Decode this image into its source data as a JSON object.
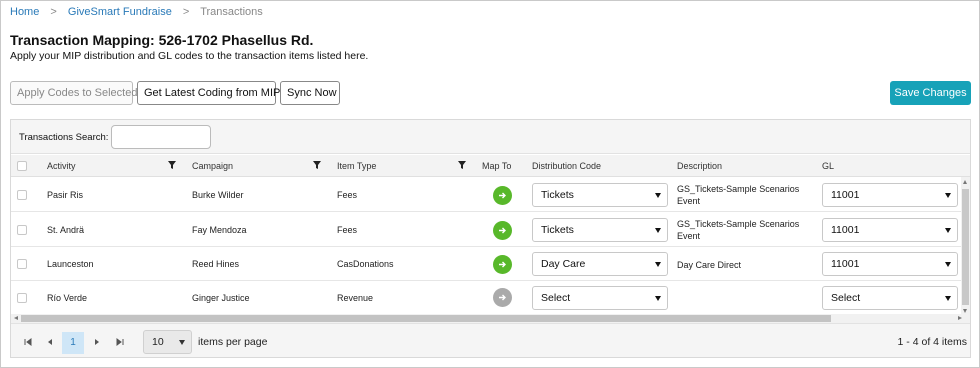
{
  "breadcrumb": {
    "home": "Home",
    "app": "GiveSmart Fundraise",
    "current": "Transactions",
    "separator": ">"
  },
  "page": {
    "title": "Transaction Mapping: 526-1702 Phasellus Rd.",
    "subtitle": "Apply your MIP distribution and GL codes to the transaction items listed here."
  },
  "toolbar": {
    "apply_codes": "Apply Codes to Selected",
    "get_latest": "Get Latest Coding from MIP",
    "sync_now": "Sync Now",
    "save_changes": "Save Changes"
  },
  "search": {
    "label": "Transactions Search:",
    "value": "",
    "placeholder": ""
  },
  "columns": {
    "activity": "Activity",
    "campaign": "Campaign",
    "item_type": "Item Type",
    "map_to": "Map To",
    "distribution_code": "Distribution Code",
    "description": "Description",
    "gl": "GL"
  },
  "rows": [
    {
      "activity": "Pasir Ris",
      "campaign": "Burke Wilder",
      "item_type": "Fees",
      "mapped": true,
      "distribution_code": "Tickets",
      "description": "GS_Tickets-Sample Scenarios Event",
      "gl": "11001"
    },
    {
      "activity": "St. Andrä",
      "campaign": "Fay Mendoza",
      "item_type": "Fees",
      "mapped": true,
      "distribution_code": "Tickets",
      "description": "GS_Tickets-Sample Scenarios Event",
      "gl": "11001"
    },
    {
      "activity": "Launceston",
      "campaign": "Reed Hines",
      "item_type": "CasDonations",
      "mapped": true,
      "distribution_code": "Day Care",
      "description": "Day Care Direct",
      "gl": "11001"
    },
    {
      "activity": "Río Verde",
      "campaign": "Ginger Justice",
      "item_type": "Revenue",
      "mapped": false,
      "distribution_code": "Select",
      "description": "",
      "gl": "Select"
    }
  ],
  "pager": {
    "current_page": "1",
    "items_per_page": "10",
    "items_per_page_label": "items per page",
    "info": "1 - 4 of 4 items"
  },
  "colors": {
    "link": "#2a7ab8",
    "save_button": "#17a2b8",
    "map_active": "#58b82a",
    "map_inactive": "#aaaaaa"
  },
  "icons": {
    "filter": "filter-icon",
    "map_arrow": "arrow-right-icon",
    "caret": "chevron-down-icon"
  }
}
